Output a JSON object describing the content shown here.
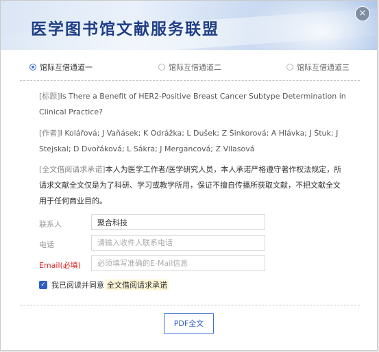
{
  "header": {
    "title": "医学图书馆文献服务联盟",
    "close_symbol": "×"
  },
  "channels": [
    {
      "label": "馆际互借通道一",
      "selected": true
    },
    {
      "label": "馆际互借通道二",
      "selected": false
    },
    {
      "label": "馆际互借通道三",
      "selected": false
    }
  ],
  "article": {
    "title_tag": "[标题]",
    "title": "Is There a Benefit of HER2-Positive Breast Cancer Subtype Determination in Clinical Practice?",
    "authors_tag": "[作者]",
    "authors": "I Kolářová; J Vaňásek; K Odrážka; L Dušek; Z Šinkorová; A Hlávka; J Štuk; J Stejskal; D Dvořáková; L Sákra; J Mergancová; Z Vilasová"
  },
  "notice": {
    "tag": "[全文借阅请求承诺]",
    "text": "本人为医学工作者/医学研究人员，本人承诺严格遵守著作权法规定，所请求文献全文仅是为了科研、学习或教学所用，保证不擅自传播所获取文献，不把文献全文用于任何商业目的。"
  },
  "form": {
    "contact_label": "联系人",
    "contact_value": "聚合科技",
    "phone_label": "电话",
    "phone_placeholder": "请输入收件人联系电话",
    "email_label": "Email(必填)",
    "email_placeholder": "必须填写准确的E-Mail信息"
  },
  "agreement": {
    "prefix": "我已阅读并同意",
    "link": "全文借阅请求承诺",
    "checked": true
  },
  "action": {
    "pdf_label": "PDF全文"
  },
  "colors": {
    "accent": "#3b6fd6",
    "required": "#e02020",
    "title": "#1f3f86"
  }
}
